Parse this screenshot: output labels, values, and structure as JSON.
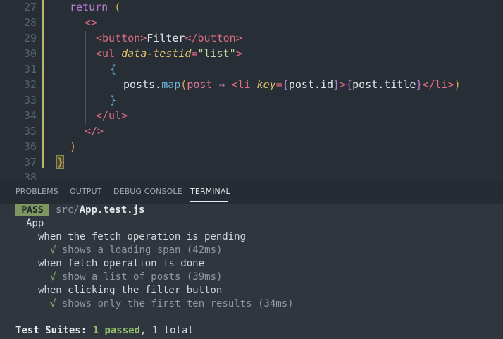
{
  "editor": {
    "lines": [
      {
        "num": "27",
        "segments": [
          {
            "c": "k",
            "t": "return "
          },
          {
            "c": "p",
            "t": "("
          }
        ]
      },
      {
        "num": "28",
        "segments": [
          {
            "c": "t",
            "t": "<>"
          }
        ]
      },
      {
        "num": "29",
        "segments": [
          {
            "c": "t",
            "t": "<button>"
          },
          {
            "c": "d",
            "t": "Filter"
          },
          {
            "c": "t",
            "t": "</button>"
          }
        ]
      },
      {
        "num": "30",
        "segments": [
          {
            "c": "t",
            "t": "<ul "
          },
          {
            "c": "a",
            "t": "data-testid"
          },
          {
            "c": "t",
            "t": "="
          },
          {
            "c": "s",
            "t": "\"list\""
          },
          {
            "c": "t",
            "t": ">"
          }
        ]
      },
      {
        "num": "31",
        "segments": [
          {
            "c": "b",
            "t": "{"
          }
        ]
      },
      {
        "num": "32",
        "segments": [
          {
            "c": "d",
            "t": "posts."
          },
          {
            "c": "f",
            "t": "map"
          },
          {
            "c": "p",
            "t": "("
          },
          {
            "c": "v",
            "t": "post"
          },
          {
            "c": "k",
            "t": " ⇒ "
          },
          {
            "c": "t",
            "t": "<li "
          },
          {
            "c": "a",
            "t": "key"
          },
          {
            "c": "t",
            "t": "="
          },
          {
            "c": "k",
            "t": "{"
          },
          {
            "c": "d",
            "t": "post.id"
          },
          {
            "c": "k",
            "t": "}"
          },
          {
            "c": "t",
            "t": ">"
          },
          {
            "c": "k",
            "t": "{"
          },
          {
            "c": "d",
            "t": "post.title"
          },
          {
            "c": "k",
            "t": "}"
          },
          {
            "c": "t",
            "t": "</li>"
          },
          {
            "c": "p",
            "t": ")"
          }
        ]
      },
      {
        "num": "33",
        "segments": [
          {
            "c": "b",
            "t": "}"
          }
        ]
      },
      {
        "num": "34",
        "segments": [
          {
            "c": "t",
            "t": "</ul>"
          }
        ]
      },
      {
        "num": "35",
        "segments": [
          {
            "c": "t",
            "t": "</>"
          }
        ]
      },
      {
        "num": "36",
        "segments": [
          {
            "c": "p",
            "t": ")"
          }
        ]
      },
      {
        "num": "37",
        "segments": [
          {
            "c": "hl-brace",
            "t": "}"
          }
        ]
      },
      {
        "num": "38",
        "segments": []
      }
    ]
  },
  "panel": {
    "tabs": [
      {
        "label": "PROBLEMS",
        "active": false
      },
      {
        "label": "OUTPUT",
        "active": false
      },
      {
        "label": "DEBUG CONSOLE",
        "active": false
      },
      {
        "label": "TERMINAL",
        "active": true
      }
    ]
  },
  "terminal": {
    "badge": "PASS",
    "path_dir": "src/",
    "path_file": "App.test.js",
    "suite": "App",
    "groups": [
      {
        "title": "when the fetch operation is pending",
        "check": "√",
        "test": "shows a loading span (42ms)"
      },
      {
        "title": "when fetch operation is done",
        "check": "√",
        "test": "show a list of posts (39ms)"
      },
      {
        "title": "when clicking the filter button",
        "check": "√",
        "test": "shows only the first ten results (34ms)"
      }
    ],
    "summary_label": "Test Suites:",
    "summary_passed": "1 passed",
    "summary_rest": ", 1 total"
  }
}
